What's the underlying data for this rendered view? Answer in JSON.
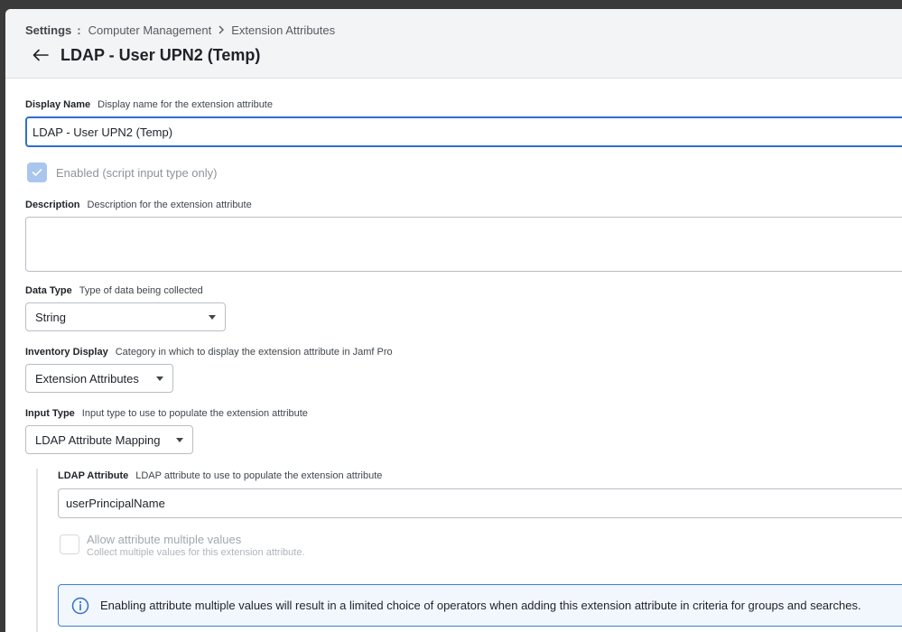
{
  "breadcrumb": {
    "root": "Settings",
    "items": [
      "Computer Management",
      "Extension Attributes"
    ]
  },
  "page_title": "LDAP - User UPN2 (Temp)",
  "display_name": {
    "label": "Display Name",
    "help": "Display name for the extension attribute",
    "value": "LDAP - User UPN2 (Temp)"
  },
  "enabled": {
    "label": "Enabled (script input type only)",
    "checked": true
  },
  "description": {
    "label": "Description",
    "help": "Description for the extension attribute",
    "value": ""
  },
  "data_type": {
    "label": "Data Type",
    "help": "Type of data being collected",
    "selected": "String"
  },
  "inventory_display": {
    "label": "Inventory Display",
    "help": "Category in which to display the extension attribute in Jamf Pro",
    "selected": "Extension Attributes"
  },
  "input_type": {
    "label": "Input Type",
    "help": "Input type to use to populate the extension attribute",
    "selected": "LDAP Attribute Mapping"
  },
  "ldap_attribute": {
    "label": "LDAP Attribute",
    "help": "LDAP attribute to use to populate the extension attribute",
    "value": "userPrincipalName"
  },
  "multiple_values": {
    "label": "Allow attribute multiple values",
    "sublabel": "Collect multiple values for this extension attribute.",
    "checked": false
  },
  "info_message": "Enabling attribute multiple values will result in a limited choice of operators when adding this extension attribute in criteria for groups and searches.",
  "colors": {
    "accent": "#2f6fd1",
    "info_border": "#3d7fd8",
    "checkbox_disabled": "#a9c6ee"
  },
  "icons": {
    "back": "arrow-left-icon",
    "breadcrumb_separator": "chevron-right-icon",
    "checkbox": "checkmark-icon",
    "dropdown": "caret-down-icon",
    "info": "info-circle-icon"
  }
}
